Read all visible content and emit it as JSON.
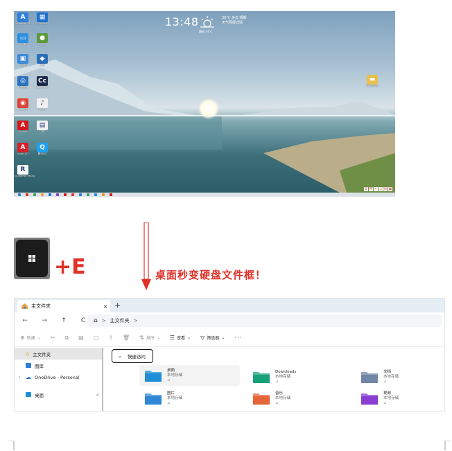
{
  "desktop": {
    "clock": "13:48",
    "weather_line1": "30°C 多云 晴朗",
    "weather_line2": "天气预报详情",
    "weather_sub": "最高 34°C",
    "icons": [
      {
        "label": "Windows 11",
        "color": "#2f7fd8",
        "glyph": "A"
      },
      {
        "label": "Outlook",
        "color": "#1f6fd1",
        "glyph": "▦"
      },
      {
        "label": "此电脑",
        "color": "#2d8fe0",
        "glyph": "▭"
      },
      {
        "label": "NVIDIA",
        "color": "#5a9a3a",
        "glyph": "●"
      },
      {
        "label": "回收站",
        "color": "#3d8ad8",
        "glyph": "▣"
      },
      {
        "label": "网络",
        "color": "#2a6fb8",
        "glyph": "◆"
      },
      {
        "label": "控制面板",
        "color": "#2b73c0",
        "glyph": "◎"
      },
      {
        "label": "Adobe CC",
        "color": "#1e2a4a",
        "glyph": "Cc"
      },
      {
        "label": "Chrome",
        "color": "#db4437",
        "glyph": "◉"
      },
      {
        "label": "iTunes",
        "color": "#f1f1f1",
        "glyph": "♪"
      },
      {
        "label": "Acrobat",
        "color": "#d6191b",
        "glyph": "A"
      },
      {
        "label": "工具",
        "color": "#f2f2f2",
        "glyph": "▤"
      },
      {
        "label": "AutoCAD",
        "color": "#d71f2a",
        "glyph": "A"
      },
      {
        "label": "腾讯QQ",
        "color": "#1ea1f2",
        "glyph": "Q"
      },
      {
        "label": "Autodesk ReCap",
        "color": "#ffffff",
        "glyph": "R"
      },
      {
        "label": "新建文件夹",
        "color": "#e7c04e",
        "glyph": "▬"
      }
    ]
  },
  "hotkey": {
    "combo": "+E",
    "caption": "桌面秒变硬盘文件框！"
  },
  "explorer": {
    "tab_title": "主文件夹",
    "tab_close": "×",
    "new_tab": "+",
    "nav": {
      "back": "←",
      "forward": "→",
      "up": "↑",
      "refresh": "C"
    },
    "address": {
      "home": "⌂",
      "sep": ">",
      "path": "主文件夹",
      "trail": ">"
    },
    "toolbar": {
      "new_label": "新建",
      "sort_label": "排序",
      "view_label": "查看",
      "filter_label": "筛选器",
      "more": "···"
    },
    "nav_pane": [
      {
        "label": "主文件夹",
        "selected": true
      },
      {
        "label": "图库",
        "selected": false
      },
      {
        "label": "OneDrive - Personal",
        "selected": false
      },
      {
        "label": "桌面",
        "selected": false
      }
    ],
    "quick_access_label": "快速访问",
    "quick_access": [
      {
        "name": "桌面",
        "sub": "本地存储",
        "color": "#1e8fd6"
      },
      {
        "name": "Downloads",
        "sub": "本地存储",
        "color": "#17a17a"
      },
      {
        "name": "文档",
        "sub": "本地存储",
        "color": "#6f86a6"
      },
      {
        "name": "图片",
        "sub": "本地存储",
        "color": "#2f88d6"
      },
      {
        "name": "音乐",
        "sub": "本地存储",
        "color": "#e5643a"
      },
      {
        "name": "视频",
        "sub": "本地存储",
        "color": "#8a3ecf"
      }
    ],
    "pin_glyph": "📌"
  },
  "colors": {
    "accent_red": "#e0322a",
    "explorer_tab_bg": "#e6eef5"
  }
}
